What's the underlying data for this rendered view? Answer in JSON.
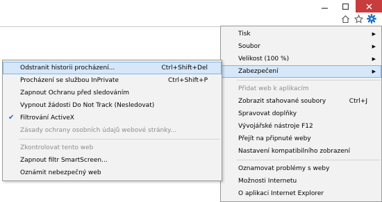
{
  "window": {
    "controls": [
      "minimize",
      "maximize",
      "close"
    ]
  },
  "toolbar": {
    "icons": [
      "home-icon",
      "star-icon",
      "gear-icon"
    ]
  },
  "main_menu": [
    {
      "label": "Tisk",
      "arrow": true
    },
    {
      "label": "Soubor",
      "arrow": true
    },
    {
      "label": "Velikost (100 %)",
      "arrow": true
    },
    {
      "label": "Zabezpečení",
      "arrow": true,
      "highlighted": true
    },
    {
      "sep": true
    },
    {
      "label": "Přidat web k aplikacím",
      "disabled": true
    },
    {
      "label": "Zobrazit stahované soubory",
      "shortcut": "Ctrl+J"
    },
    {
      "label": "Spravovat doplňky"
    },
    {
      "label": "Vývojářské nástroje F12"
    },
    {
      "label": "Přejít na připnuté weby"
    },
    {
      "label": "Nastavení kompatibilního zobrazení"
    },
    {
      "sep": true
    },
    {
      "label": "Oznamovat problémy s weby"
    },
    {
      "label": "Možnosti Internetu"
    },
    {
      "label": "O aplikaci Internet Explorer"
    }
  ],
  "security_menu": [
    {
      "label": "Odstranit historii procházení...",
      "shortcut": "Ctrl+Shift+Del",
      "highlighted": true
    },
    {
      "label": "Procházení se službou InPrivate",
      "shortcut": "Ctrl+Shift+P"
    },
    {
      "label": "Zapnout Ochranu před sledováním"
    },
    {
      "label": "Vypnout žádosti Do Not Track (Nesledovat)"
    },
    {
      "label": "Filtrování ActiveX",
      "checked": true
    },
    {
      "label": "Zásady ochrany osobních údajů webové stránky...",
      "disabled": true
    },
    {
      "sep": true
    },
    {
      "label": "Zkontrolovat tento web",
      "disabled": true
    },
    {
      "label": "Zapnout filtr SmartScreen..."
    },
    {
      "label": "Oznámit nebezpečný web"
    }
  ]
}
